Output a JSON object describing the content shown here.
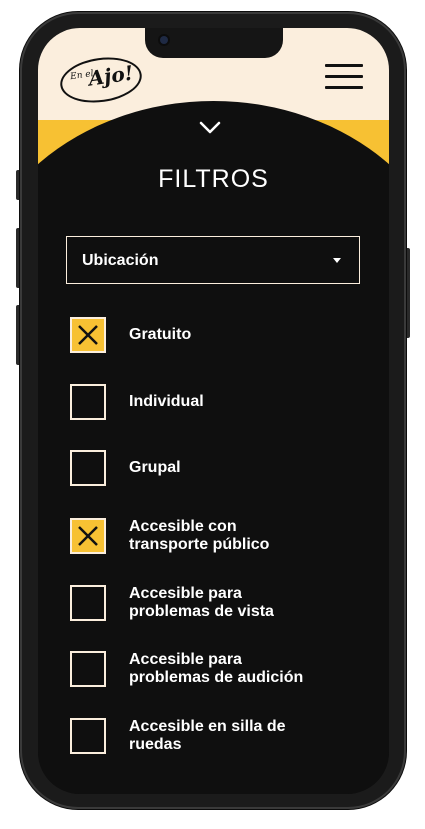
{
  "header": {
    "logo_small": "En el",
    "logo_big": "Ajo!",
    "menu_icon": "hamburger-icon",
    "collapse_icon": "chevron-down-icon"
  },
  "filters": {
    "title": "FILTROS",
    "location_select": {
      "value": "Ubicación"
    },
    "options": [
      {
        "label": "Gratuito",
        "checked": true
      },
      {
        "label": "Individual",
        "checked": false
      },
      {
        "label": "Grupal",
        "checked": false
      },
      {
        "label_line1": "Accesible con",
        "label_line2": "transporte público",
        "checked": true
      },
      {
        "label_line1": "Accesible para",
        "label_line2": "problemas de vista",
        "checked": false
      },
      {
        "label_line1": "Accesible para",
        "label_line2": "problemas de audición",
        "checked": false
      },
      {
        "label_line1": "Accesible en silla de",
        "label_line2": "ruedas",
        "checked": false
      }
    ]
  },
  "colors": {
    "background": "#0f0f0f",
    "header_cream": "#fbeedd",
    "accent_yellow": "#f7c133",
    "text": "#ffffff"
  }
}
